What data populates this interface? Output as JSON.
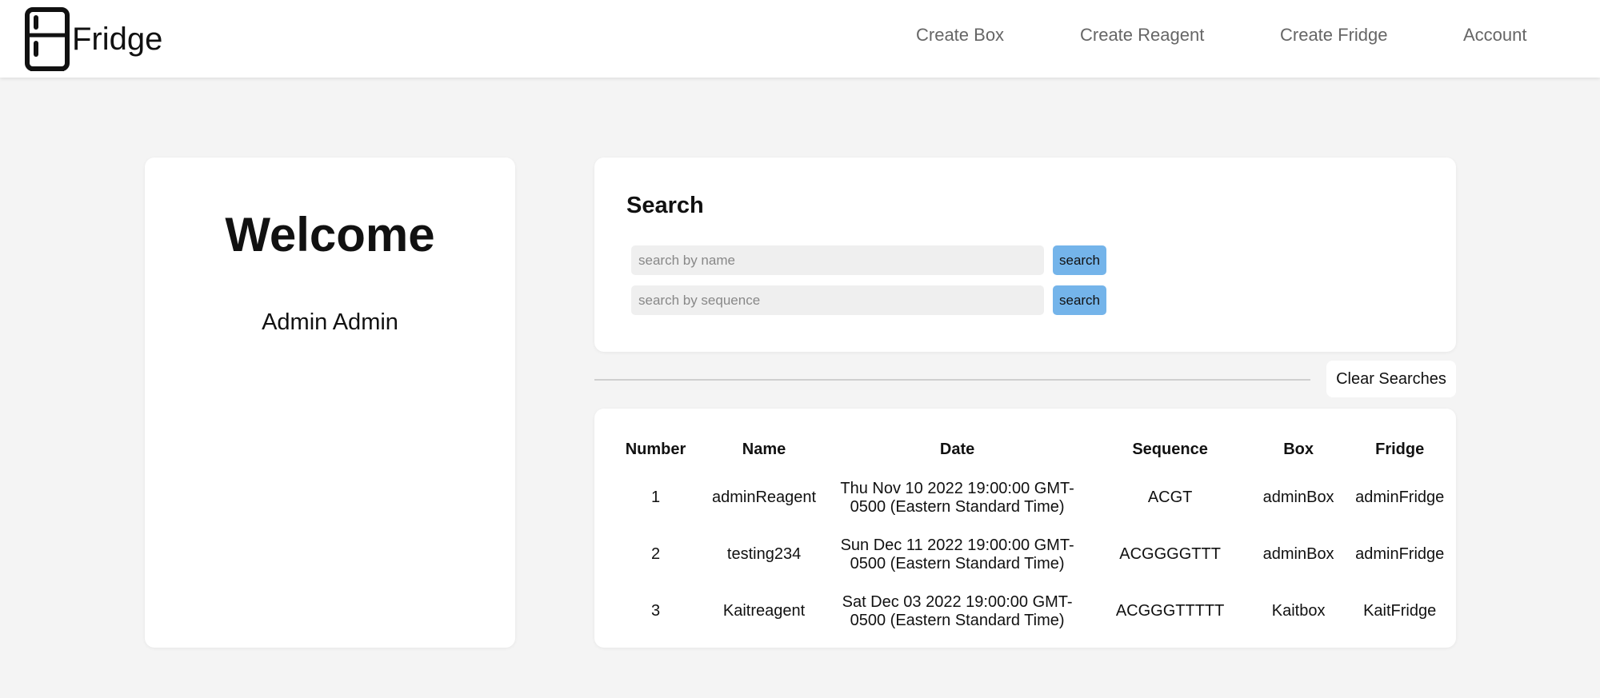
{
  "header": {
    "brand": "Fridge",
    "icon": "fridge-icon",
    "nav": [
      {
        "label": "Create Box"
      },
      {
        "label": "Create Reagent"
      },
      {
        "label": "Create Fridge"
      },
      {
        "label": "Account"
      }
    ]
  },
  "welcome": {
    "title": "Welcome",
    "user": "Admin Admin"
  },
  "search": {
    "title": "Search",
    "name_placeholder": "search by name",
    "name_value": "",
    "sequence_placeholder": "search by sequence",
    "sequence_value": "",
    "button_label": "search",
    "clear_label": "Clear Searches"
  },
  "table": {
    "columns": [
      "Number",
      "Name",
      "Date",
      "Sequence",
      "Box",
      "Fridge"
    ],
    "rows": [
      {
        "number": "1",
        "name": "adminReagent",
        "date": "Thu Nov 10 2022 19:00:00 GMT-0500 (Eastern Standard Time)",
        "sequence": "ACGT",
        "box": "adminBox",
        "fridge": "adminFridge"
      },
      {
        "number": "2",
        "name": "testing234",
        "date": "Sun Dec 11 2022 19:00:00 GMT-0500 (Eastern Standard Time)",
        "sequence": "ACGGGGTTT",
        "box": "adminBox",
        "fridge": "adminFridge"
      },
      {
        "number": "3",
        "name": "Kaitreagent",
        "date": "Sat Dec 03 2022 19:00:00 GMT-0500 (Eastern Standard Time)",
        "sequence": "ACGGGTTTTT",
        "box": "Kaitbox",
        "fridge": "KaitFridge"
      }
    ]
  },
  "colors": {
    "page_bg": "#f4f4f4",
    "card_bg": "#ffffff",
    "search_button": "#74b4ea",
    "nav_text": "#666666"
  }
}
